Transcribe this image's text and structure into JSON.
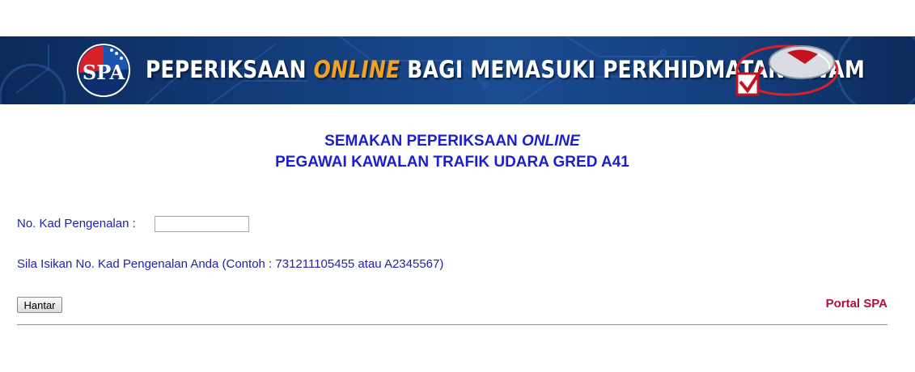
{
  "banner": {
    "title_part1": "PEPERIKSAAN ",
    "title_highlight": "ONLINE",
    "title_part2": " BAGI MEMASUKI PERKHIDMATAN AWAM",
    "logo_text": "SPA",
    "icon": "mouse-checkmark-icon",
    "colors": {
      "background": "#143f7e",
      "title": "#ffffff",
      "highlight": "#f2a21e"
    }
  },
  "heading": {
    "line1_prefix": "SEMAKAN PEPERIKSAAN ",
    "line1_italic": "ONLINE",
    "line2": "PEGAWAI KAWALAN TRAFIK UDARA GRED A41",
    "color": "#1b1fcf"
  },
  "form": {
    "ic_label": "No. Kad Pengenalan :",
    "ic_value": "",
    "hint": "Sila Isikan No. Kad Pengenalan Anda (Contoh : 731211105455 atau A2345567)",
    "submit_label": "Hantar"
  },
  "links": {
    "portal_label": "Portal SPA",
    "color": "#b0103a"
  }
}
